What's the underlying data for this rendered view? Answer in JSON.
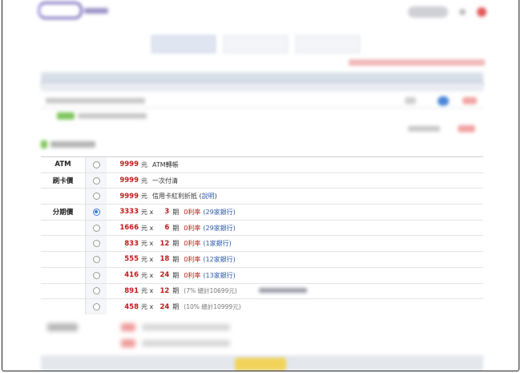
{
  "payment": {
    "rows": [
      {
        "category": "ATM",
        "checked": false,
        "amount": "9999",
        "unit": "元",
        "desc": "ATM轉帳"
      },
      {
        "category": "刷卡價",
        "checked": false,
        "amount": "9999",
        "unit": "元",
        "desc": "一次付清"
      },
      {
        "category": "",
        "checked": false,
        "amount": "9999",
        "unit": "元",
        "desc": "信用卡紅利折抵",
        "desc_link": "說明"
      },
      {
        "category": "分期價",
        "checked": true,
        "amount": "3333",
        "unit": "元 x",
        "periods": "3",
        "qi": "期",
        "rate": "0利率",
        "bank": "(29家銀行)"
      },
      {
        "category": "",
        "checked": false,
        "amount": "1666",
        "unit": "元 x",
        "periods": "6",
        "qi": "期",
        "rate": "0利率",
        "bank": "(29家銀行)"
      },
      {
        "category": "",
        "checked": false,
        "amount": "833",
        "unit": "元 x",
        "periods": "12",
        "qi": "期",
        "rate": "0利率",
        "bank": "(1家銀行)"
      },
      {
        "category": "",
        "checked": false,
        "amount": "555",
        "unit": "元 x",
        "periods": "18",
        "qi": "期",
        "rate": "0利率",
        "bank": "(12家銀行)"
      },
      {
        "category": "",
        "checked": false,
        "amount": "416",
        "unit": "元 x",
        "periods": "24",
        "qi": "期",
        "rate": "0利率",
        "bank": "(13家銀行)"
      },
      {
        "category": "",
        "checked": false,
        "amount": "891",
        "unit": "元 x",
        "periods": "12",
        "qi": "期",
        "total": "(7% 總計10699元)"
      },
      {
        "category": "",
        "checked": false,
        "amount": "458",
        "unit": "元 x",
        "periods": "24",
        "qi": "期",
        "total": "(10% 總計10999元)"
      }
    ]
  },
  "colors": {
    "price_red": "#c21a1a",
    "link_blue": "#2a5aa8",
    "radio_blue": "#3a7bd5",
    "accent_green": "#7fc65d",
    "checkout_yellow": "#f2d35a"
  }
}
